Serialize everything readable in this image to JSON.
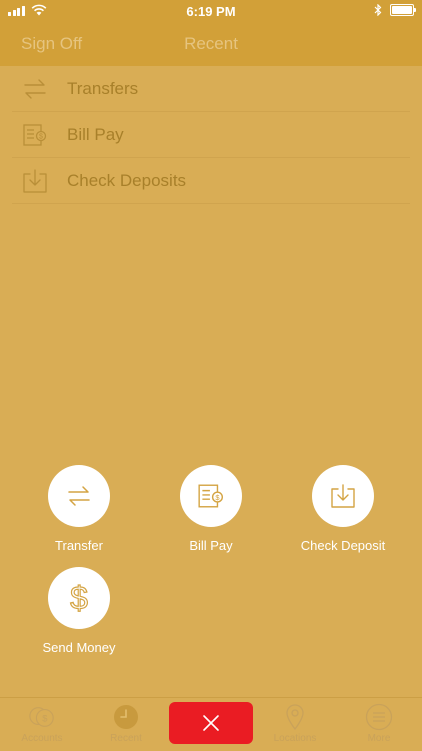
{
  "status_bar": {
    "time": "6:19 PM"
  },
  "nav": {
    "left": "Sign Off",
    "title": "Recent"
  },
  "recent_items": [
    {
      "label": "Transfers",
      "icon": "transfer-arrows-icon"
    },
    {
      "label": "Bill Pay",
      "icon": "bill-pay-icon"
    },
    {
      "label": "Check Deposits",
      "icon": "download-tray-icon"
    }
  ],
  "actions": [
    {
      "label": "Transfer",
      "icon": "transfer-arrows-icon"
    },
    {
      "label": "Bill Pay",
      "icon": "bill-pay-icon"
    },
    {
      "label": "Check Deposit",
      "icon": "download-tray-icon"
    },
    {
      "label": "Send Money",
      "icon": "dollar-sign-icon"
    }
  ],
  "tabs": [
    {
      "label": "Accounts",
      "icon": "accounts-coins-icon"
    },
    {
      "label": "Recent",
      "icon": "clock-icon"
    },
    {
      "label": "Locations",
      "icon": "map-pin-icon"
    },
    {
      "label": "More",
      "icon": "menu-circle-icon"
    }
  ],
  "colors": {
    "background": "#d9ad55",
    "header": "#d2a038",
    "accent": "#d4a443",
    "close": "#ea1c23"
  }
}
